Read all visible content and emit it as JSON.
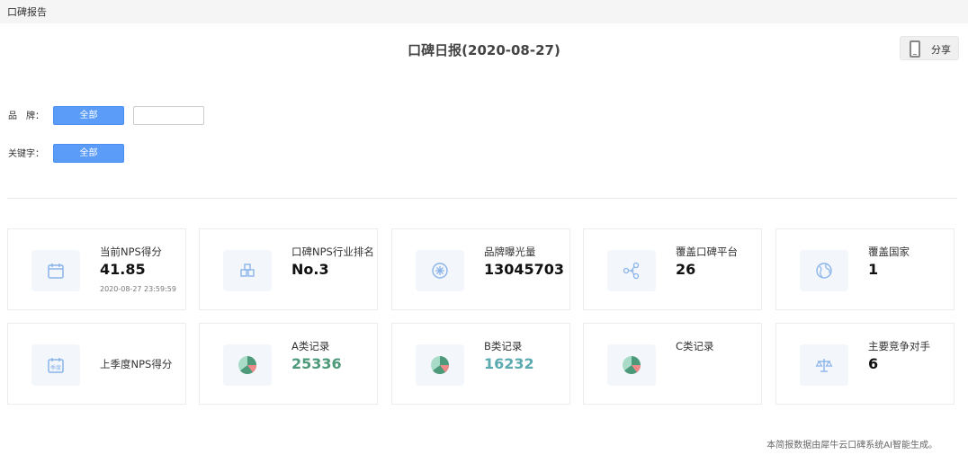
{
  "topbar": {
    "title": "口碑报告"
  },
  "header": {
    "title": "口碑日报(2020-08-27)",
    "share_label": "分享"
  },
  "filters": {
    "brand_label": "品　牌：",
    "brand_button": "全部",
    "brand_input_value": "",
    "keyword_label": "关键字：",
    "keyword_button": "全部"
  },
  "cards": [
    {
      "label": "当前NPS得分",
      "value": "41.85",
      "sub": "2020-08-27 23:59:59",
      "icon": "calendar-icon"
    },
    {
      "label": "口碑NPS行业排名",
      "value": "No.3",
      "icon": "rank-blocks-icon"
    },
    {
      "label": "品牌曝光量",
      "value": "13045703",
      "icon": "exposure-icon"
    },
    {
      "label": "覆盖口碑平台",
      "value": "26",
      "icon": "share-nodes-icon"
    },
    {
      "label": "覆盖国家",
      "value": "1",
      "icon": "globe-icon"
    },
    {
      "label": "上季度NPS得分",
      "value": "",
      "icon": "season-calendar-icon",
      "icon_text": "季度"
    },
    {
      "label": "A类记录",
      "value": "25336",
      "icon": "pie-chart-icon"
    },
    {
      "label": "B类记录",
      "value": "16232",
      "icon": "pie-chart-icon"
    },
    {
      "label": "C类记录",
      "value": "",
      "icon": "pie-chart-icon"
    },
    {
      "label": "主要竞争对手",
      "value": "6",
      "icon": "balance-scale-icon"
    }
  ],
  "colors": {
    "accent": "#5a9cf8",
    "icon_blue": "#8ab4ea",
    "pie_green": "#4d9a7a",
    "pie_light": "#a8dcc8",
    "pie_pink": "#f08a8a",
    "value_green": "#4d9a7a",
    "value_teal": "#5aaab0"
  },
  "footer": {
    "note": "本简报数据由犀牛云口碑系统AI智能生成。"
  }
}
